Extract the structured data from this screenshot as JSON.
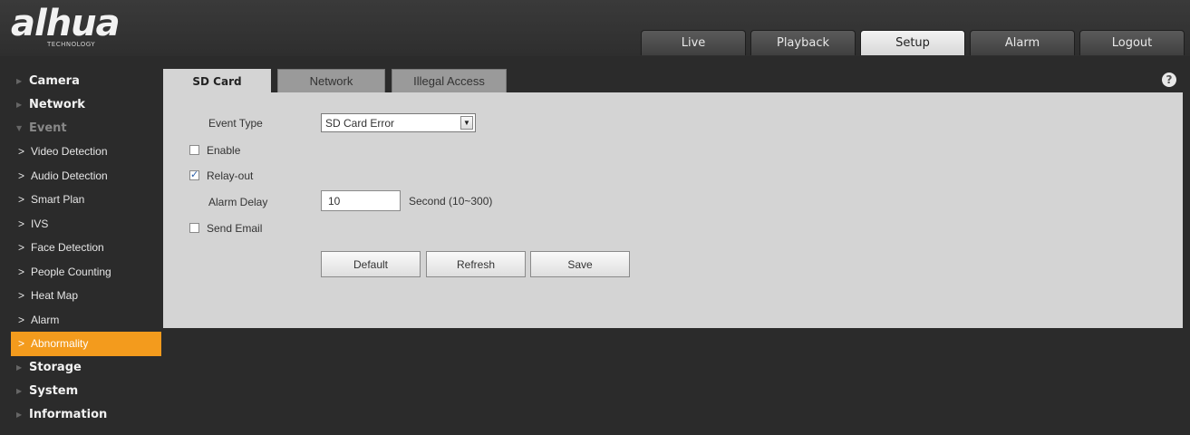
{
  "header": {
    "logo": "alhua",
    "logo_sub": "TECHNOLOGY",
    "nav": [
      "Live",
      "Playback",
      "Setup",
      "Alarm",
      "Logout"
    ],
    "active_nav": "Setup"
  },
  "sidebar": {
    "camera": "Camera",
    "network": "Network",
    "event": "Event",
    "event_items": [
      "Video Detection",
      "Audio Detection",
      "Smart Plan",
      "IVS",
      "Face Detection",
      "People Counting",
      "Heat Map",
      "Alarm",
      "Abnormality"
    ],
    "active_item": "Abnormality",
    "storage": "Storage",
    "system": "System",
    "information": "Information"
  },
  "tabs": [
    "SD Card",
    "Network",
    "Illegal Access"
  ],
  "active_tab": "SD Card",
  "form": {
    "event_type_label": "Event Type",
    "event_type_value": "SD Card Error",
    "enable_label": "Enable",
    "enable_checked": false,
    "relay_label": "Relay-out",
    "relay_checked": true,
    "alarm_delay_label": "Alarm Delay",
    "alarm_delay_value": "10",
    "alarm_delay_unit": "Second (10~300)",
    "send_email_label": "Send Email",
    "send_email_checked": false
  },
  "buttons": {
    "default": "Default",
    "refresh": "Refresh",
    "save": "Save"
  },
  "colors": {
    "accent": "#f39b1d",
    "panel": "#d4d4d4",
    "background": "#2b2b2b"
  }
}
